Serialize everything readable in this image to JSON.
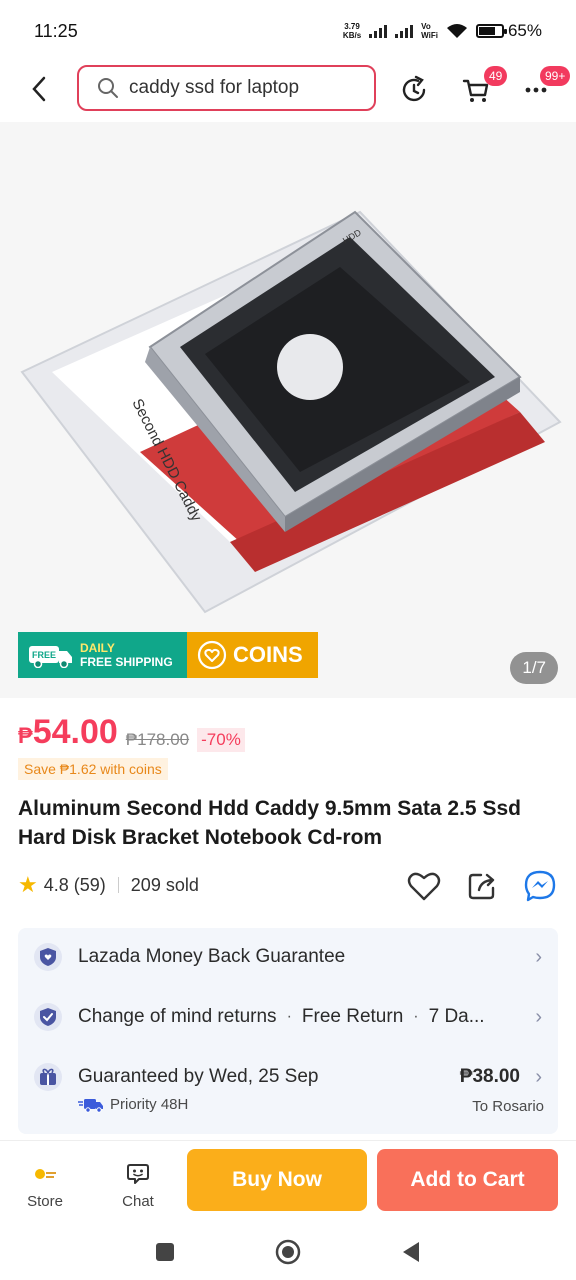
{
  "status_bar": {
    "time": "11:25",
    "net_speed_value": "3.79",
    "net_speed_unit": "KB/s",
    "volte_top": "Vo",
    "volte_bottom": "WiFi",
    "battery": "65%",
    "battery_level": 0.65
  },
  "topnav": {
    "search_text": "caddy ssd for laptop",
    "cart_count": "49",
    "more_count": "99+"
  },
  "gallery": {
    "pager": "1/7",
    "badge_daily": "DAILY",
    "badge_free": "FREE SHIPPING",
    "truck_label": "FREE",
    "badge_coins": "COINS",
    "product_box_text": "Second HDD Caddy",
    "product_tray_text": "HDD"
  },
  "product": {
    "currency": "₱",
    "price": "54.00",
    "original_price": "₱178.00",
    "discount": "-70%",
    "coins_saving": "Save ₱1.62 with coins",
    "title": "Aluminum Second Hdd Caddy 9.5mm Sata 2.5 Ssd Hard Disk Bracket Notebook Cd-rom",
    "rating": "4.8",
    "review_count": "(59)",
    "sold": "209 sold"
  },
  "services": {
    "guarantee": "Lazada Money Back Guarantee",
    "returns_label": "Change of mind returns",
    "returns_free": "Free Return",
    "returns_days": "7 Da...",
    "delivery": "Guaranteed by Wed, 25 Sep",
    "shipping_fee": "₱38.00",
    "priority": "Priority 48H",
    "destination": "To Rosario"
  },
  "bottom_bar": {
    "store": "Store",
    "chat": "Chat",
    "buy_now": "Buy Now",
    "add_to_cart": "Add to Cart"
  },
  "colors": {
    "accent": "#f53d5c",
    "buy_now": "#fbae1a",
    "add_to_cart": "#f9705a",
    "free_shipping": "#10a78a",
    "coins": "#f0a500"
  }
}
